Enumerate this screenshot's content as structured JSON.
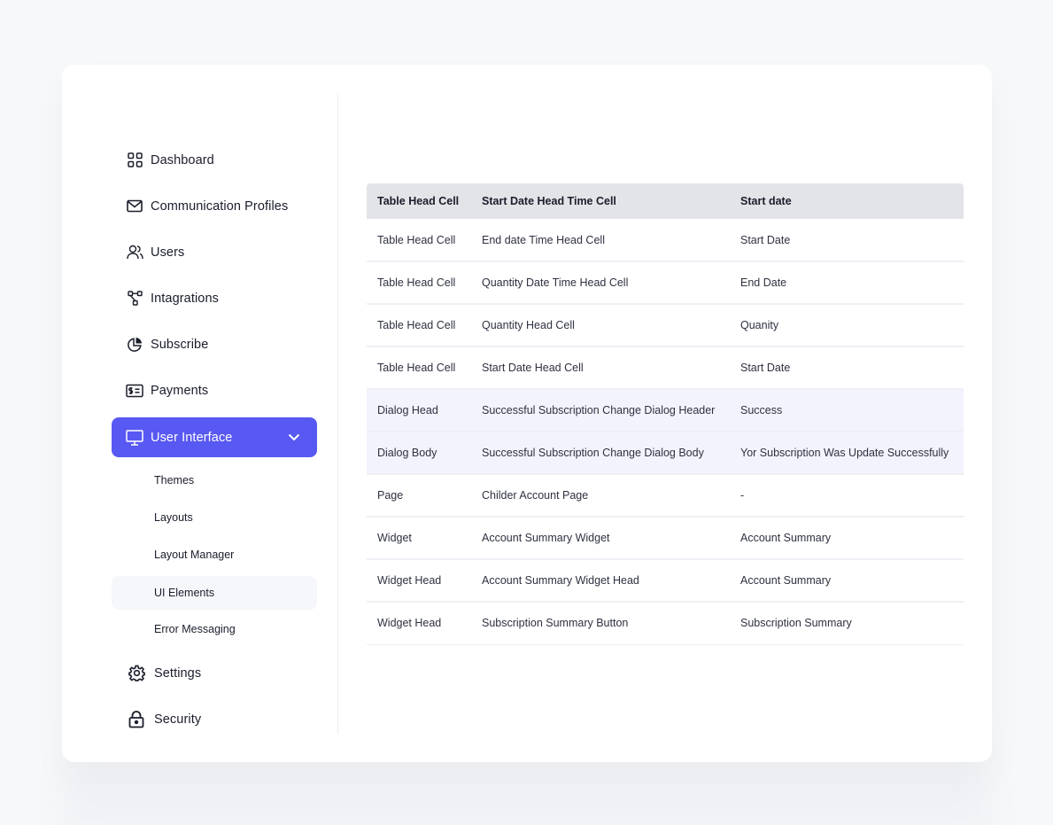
{
  "sidebar": {
    "items": [
      {
        "label": "Dashboard",
        "icon": "dashboard-grid-icon"
      },
      {
        "label": "Communication Profiles",
        "icon": "mail-icon"
      },
      {
        "label": "Users",
        "icon": "users-icon"
      },
      {
        "label": "Intagrations",
        "icon": "integrations-icon"
      },
      {
        "label": "Subscribe",
        "icon": "pie-chart-icon"
      },
      {
        "label": "Payments",
        "icon": "payment-icon"
      },
      {
        "label": "User Interface",
        "icon": "monitor-icon",
        "active": true
      }
    ],
    "sub_items": [
      {
        "label": "Themes"
      },
      {
        "label": "Layouts"
      },
      {
        "label": "Layout Manager"
      },
      {
        "label": "UI Elements",
        "selected": true
      },
      {
        "label": "Error Messaging"
      }
    ],
    "bottom_items": [
      {
        "label": "Settings",
        "icon": "gear-icon"
      },
      {
        "label": "Security",
        "icon": "lock-icon"
      }
    ]
  },
  "table": {
    "headers": [
      "Table  Head Cell",
      "Start Date Head Time Cell",
      "Start date"
    ],
    "rows": [
      [
        "Table Head  Cell",
        "End date Time Head Cell",
        "Start Date"
      ],
      [
        "Table Head  Cell",
        "Quantity Date Time Head Cell",
        "End Date"
      ],
      [
        "Table Head  Cell",
        "Quantity Head Cell",
        "Quanity"
      ],
      [
        "Table Head  Cell",
        "Start Date Head Cell",
        "Start Date"
      ],
      [
        "Dialog Head",
        "Successful Subscription Change Dialog Header",
        "Success"
      ],
      [
        "Dialog Body",
        "Successful Subscription Change Dialog Body",
        "Yor Subscription Was Update Successfully"
      ],
      [
        "Page",
        "Childer Account Page",
        "-"
      ],
      [
        "Widget",
        "Account Summary Widget",
        "Account Summary"
      ],
      [
        "Widget  Head",
        "Account Summary Widget  Head",
        "Account Summary"
      ],
      [
        "Widget  Head",
        "Subscription Summary Button",
        "Subscription Summary"
      ]
    ],
    "highlighted_rows": [
      4,
      5
    ]
  },
  "colors": {
    "accent": "#5858f2",
    "table_header_bg": "#e3e4e7",
    "highlight_row_bg": "#f3f3fd"
  }
}
